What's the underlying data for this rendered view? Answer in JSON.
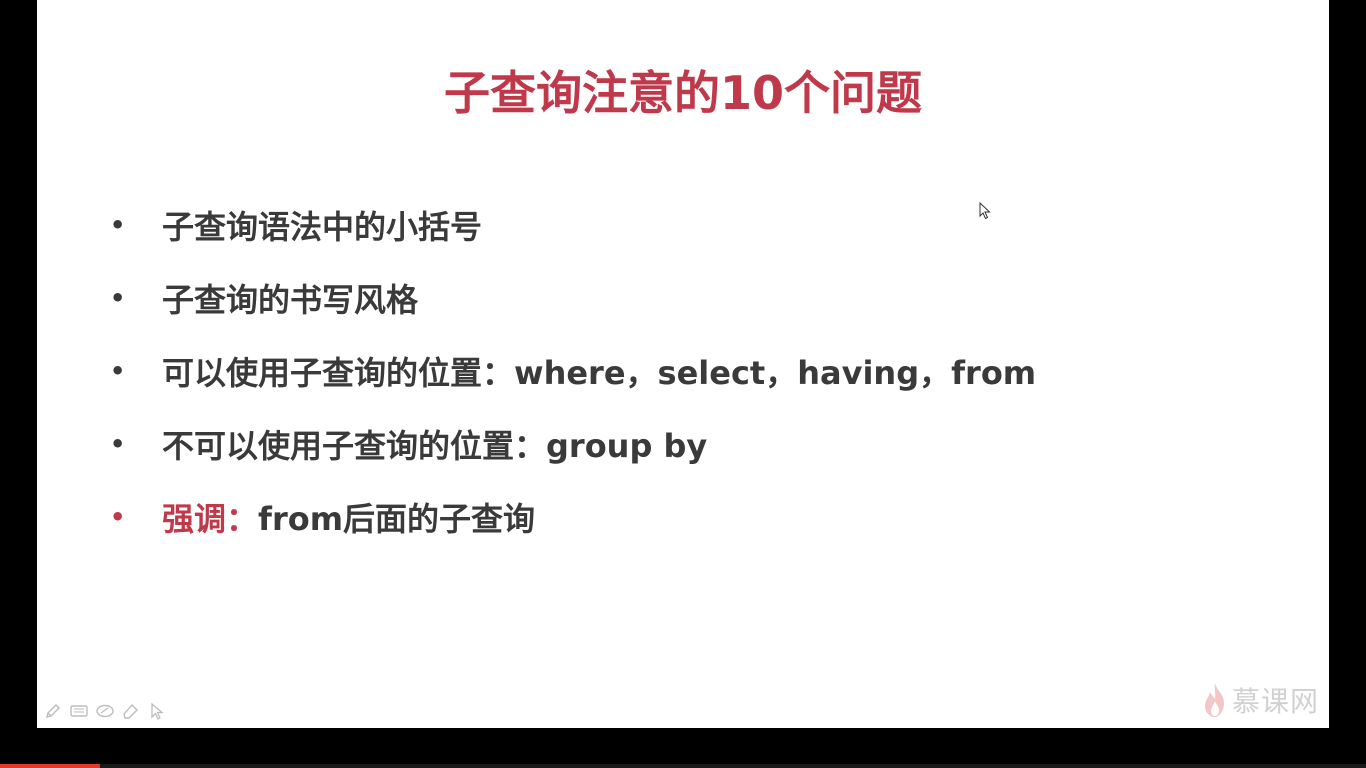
{
  "slide": {
    "title": "子查询注意的10个问题",
    "bullets": [
      {
        "text": "子查询语法中的小括号"
      },
      {
        "text": "子查询的书写风格"
      },
      {
        "text": "可以使用子查询的位置：where，select，having，from"
      },
      {
        "text": "不可以使用子查询的位置：group by"
      }
    ],
    "emphasis": {
      "label": "强调：",
      "text": "from后面的子查询"
    },
    "bullet_char": "•"
  },
  "toolbar": {
    "icons": [
      "pen-icon",
      "keyboard-icon",
      "eraser-icon",
      "highlighter-icon",
      "pointer-icon"
    ]
  },
  "brand": {
    "name": "慕课网",
    "icon": "flame-icon"
  },
  "playback": {
    "progress": 0.073
  },
  "colors": {
    "accent": "#c0394b",
    "body_text": "#3a3a3a",
    "progress": "#e03a2a",
    "background": "#ffffff"
  }
}
